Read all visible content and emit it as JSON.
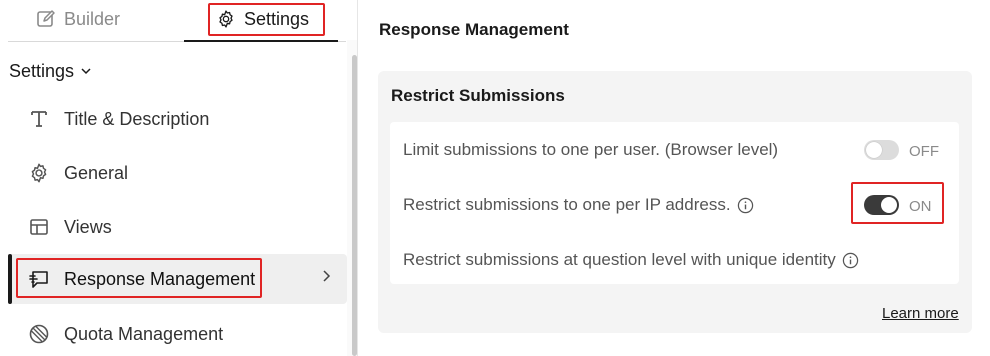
{
  "tabs": {
    "builder": {
      "label": "Builder",
      "icon": "edit-icon",
      "active": false
    },
    "settings": {
      "label": "Settings",
      "icon": "gear-icon",
      "active": true
    }
  },
  "sidebar": {
    "section_label": "Settings",
    "items": [
      {
        "label": "Title & Description",
        "icon": "text-t-icon",
        "active": false
      },
      {
        "label": "General",
        "icon": "gear-icon",
        "active": false
      },
      {
        "label": "Views",
        "icon": "layout-icon",
        "active": false
      },
      {
        "label": "Response Management",
        "icon": "chat-response-icon",
        "active": true
      },
      {
        "label": "Quota Management",
        "icon": "quota-icon",
        "active": false
      }
    ]
  },
  "main": {
    "title": "Response Management",
    "card_title": "Restrict Submissions",
    "rows": [
      {
        "label": "Limit submissions to one per user. (Browser level)",
        "toggle_state": "OFF",
        "info": false
      },
      {
        "label": "Restrict submissions to one per IP address.",
        "toggle_state": "ON",
        "info": true
      },
      {
        "label": "Restrict submissions at question level with unique identity",
        "info": true
      }
    ],
    "learn_more": "Learn more"
  },
  "colors": {
    "highlight": "#e02424",
    "toggle_on": "#3a3a3a",
    "toggle_off": "#dcdcdc",
    "active_bg": "#efefef"
  }
}
